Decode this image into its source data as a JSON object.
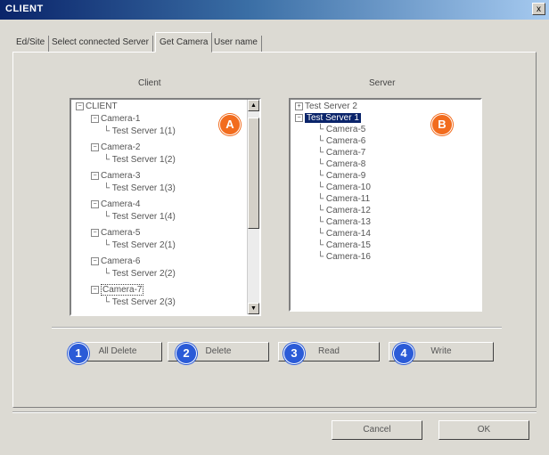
{
  "window": {
    "title": "CLIENT",
    "close_label": "x"
  },
  "tabs": [
    "Ed/Site",
    "Select connected Server",
    "Get Camera",
    "User name"
  ],
  "active_tab": "Get Camera",
  "client": {
    "title": "Client",
    "root": "CLIENT",
    "rows": [
      {
        "label": "Camera-1",
        "child": "Test Server 1(1)"
      },
      {
        "label": "Camera-2",
        "child": "Test Server 1(2)"
      },
      {
        "label": "Camera-3",
        "child": "Test Server 1(3)"
      },
      {
        "label": "Camera-4",
        "child": "Test Server 1(4)"
      },
      {
        "label": "Camera-5",
        "child": "Test Server 2(1)"
      },
      {
        "label": "Camera-6",
        "child": "Test Server 2(2)"
      },
      {
        "label": "Camera-7",
        "child": "Test Server 2(3)"
      }
    ]
  },
  "server": {
    "title": "Server",
    "servers": [
      "Test Server 2",
      "Test Server 1"
    ],
    "cameras": [
      "Camera-5",
      "Camera-6",
      "Camera-7",
      "Camera-8",
      "Camera-9",
      "Camera-10",
      "Camera-11",
      "Camera-12",
      "Camera-13",
      "Camera-14",
      "Camera-15",
      "Camera-16"
    ]
  },
  "badges": {
    "a": "A",
    "b": "B",
    "one": "1",
    "two": "2",
    "three": "3",
    "four": "4"
  },
  "buttons": {
    "all_delete": "All Delete",
    "delete": "Delete",
    "read": "Read",
    "write": "Write",
    "cancel": "Cancel",
    "ok": "OK"
  },
  "colors": {
    "badge_orange": "#f26c1e",
    "badge_blue": "#2b5bd7",
    "selection": "#0a246a"
  }
}
